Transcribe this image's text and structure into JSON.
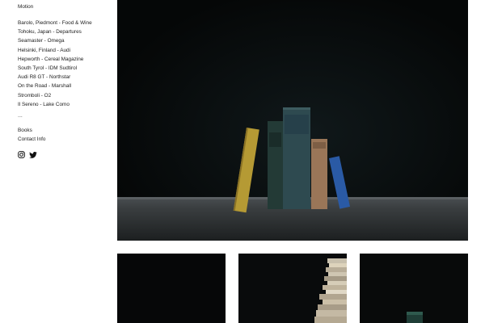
{
  "sidebar": {
    "top_item": "Motion",
    "projects": [
      "Barolo, Piedmont - Food & Wine",
      "Tohoku, Japan - Departures",
      "Seamaster - Omega",
      "Helsinki, Finland - Audi",
      "Hepworth - Cereal Magazine",
      "South Tyrol - IDM Sudtirol",
      "Audi R8 GT - Northstar",
      "On the Road - Marshall",
      "Stromboli - O2",
      "Il Sereno - Lake Como"
    ],
    "ellipsis": "...",
    "extra": [
      "Books",
      "Contact Info"
    ],
    "social_icons": [
      "instagram-icon",
      "twitter-icon"
    ]
  },
  "colors": {
    "background": "#ffffff",
    "text": "#222222",
    "photo_dark": "#07090a"
  }
}
